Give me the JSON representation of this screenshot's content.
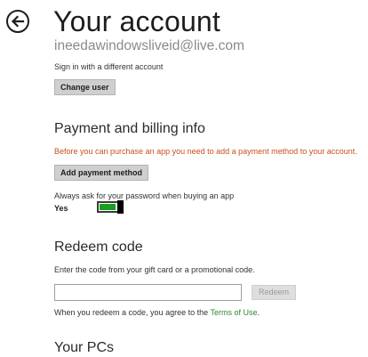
{
  "header": {
    "back_icon": "back-arrow-icon",
    "title": "Your account",
    "email": "ineedawindowsliveid@live.com"
  },
  "account": {
    "sign_in_text": "Sign in with a different account",
    "change_user_label": "Change user"
  },
  "payment": {
    "heading": "Payment and billing info",
    "warning": "Before you can purchase an app you need to add a payment method to your account.",
    "add_payment_label": "Add payment method",
    "password_prompt": "Always ask for your password when buying an app",
    "toggle_state": "Yes",
    "toggle_on": true,
    "accent_color": "#199e1e",
    "warning_color": "#c8501c"
  },
  "redeem": {
    "heading": "Redeem code",
    "instructions": "Enter the code from your gift card or a promotional code.",
    "input_value": "",
    "button_label": "Redeem",
    "terms_prefix": "When you redeem a code, you agree to the ",
    "terms_link": "Terms of Use",
    "terms_suffix": ".",
    "link_color": "#2f8a2f"
  },
  "pcs": {
    "heading": "Your PCs"
  }
}
